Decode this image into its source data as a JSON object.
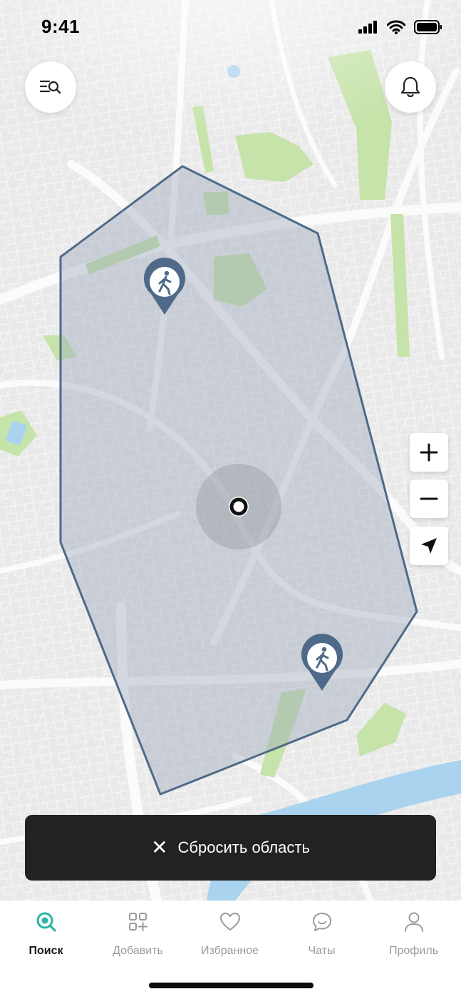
{
  "status_bar": {
    "time": "9:41"
  },
  "reset_button": {
    "label": "Сбросить область"
  },
  "tabs": [
    {
      "label": "Поиск",
      "icon": "search-tab-icon",
      "active": true
    },
    {
      "label": "Добавить",
      "icon": "add-grid-icon",
      "active": false
    },
    {
      "label": "Избранное",
      "icon": "heart-icon",
      "active": false
    },
    {
      "label": "Чаты",
      "icon": "chat-icon",
      "active": false
    },
    {
      "label": "Профиль",
      "icon": "profile-icon",
      "active": false
    }
  ],
  "colors": {
    "accent": "#2bb5a6",
    "polygon_stroke": "#4e6a88",
    "polygon_fill": "#9aa7b9",
    "park": "#c6e3a9",
    "water": "#a9d3ee",
    "button_dark": "#222222"
  }
}
